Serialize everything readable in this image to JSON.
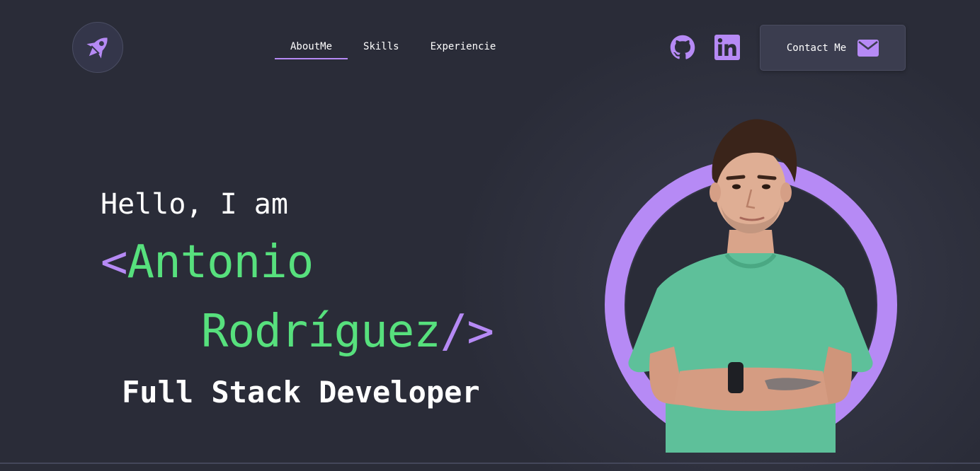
{
  "nav": {
    "items": [
      {
        "label": "AboutMe",
        "active": true
      },
      {
        "label": "Skills",
        "active": false
      },
      {
        "label": "Experiencie",
        "active": false
      }
    ]
  },
  "header": {
    "contact_label": "Contact Me",
    "logo_icon": "rocket-icon",
    "social": [
      "github-icon",
      "linkedin-icon"
    ],
    "contact_icon": "envelope-icon"
  },
  "hero": {
    "greeting": "Hello, I am",
    "open_bracket": "<",
    "first_name": "Antonio",
    "last_name": "Rodríguez",
    "close_bracket": "/>",
    "role": "Full Stack Developer"
  },
  "colors": {
    "background": "#2a2c38",
    "accent": "#b68af5",
    "name": "#57e07d",
    "shirt": "#5ec09a"
  }
}
